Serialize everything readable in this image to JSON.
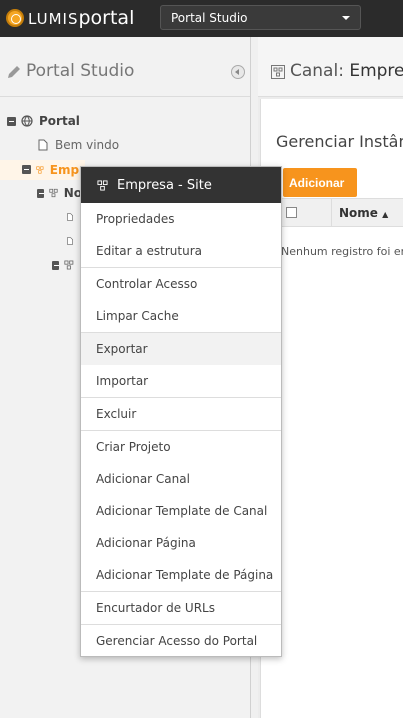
{
  "app": {
    "brand": "LUMISportal",
    "brand_prefix": "LUMIS",
    "brand_suffix": "portal",
    "selector_value": "Portal Studio"
  },
  "left_panel": {
    "title": "Portal Studio"
  },
  "tree": {
    "portal": "Portal",
    "bem_vindo": "Bem vindo",
    "empresa": "Empr",
    "no": "No"
  },
  "right_panel": {
    "title_prefix": "Canal:",
    "title_value": "Empres",
    "manage_title": "Gerenciar Instânc",
    "add_button": "Adicionar",
    "column_name": "Nome",
    "sort_indicator": "▲",
    "empty_message": "Nenhum registro foi en"
  },
  "context_menu": {
    "title": "Empresa - Site",
    "items": [
      "Propriedades",
      "Editar a estrutura",
      "Controlar Acesso",
      "Limpar Cache",
      "Exportar",
      "Importar",
      "Excluir",
      "Criar Projeto",
      "Adicionar Canal",
      "Adicionar Template de Canal",
      "Adicionar Página",
      "Adicionar Template de Página",
      "Encurtador de URLs",
      "Gerenciar Acesso do Portal"
    ],
    "hovered": "Exportar"
  },
  "colors": {
    "accent": "#f7941d",
    "topbar": "#2b2b2b",
    "menu_header": "#333333"
  }
}
